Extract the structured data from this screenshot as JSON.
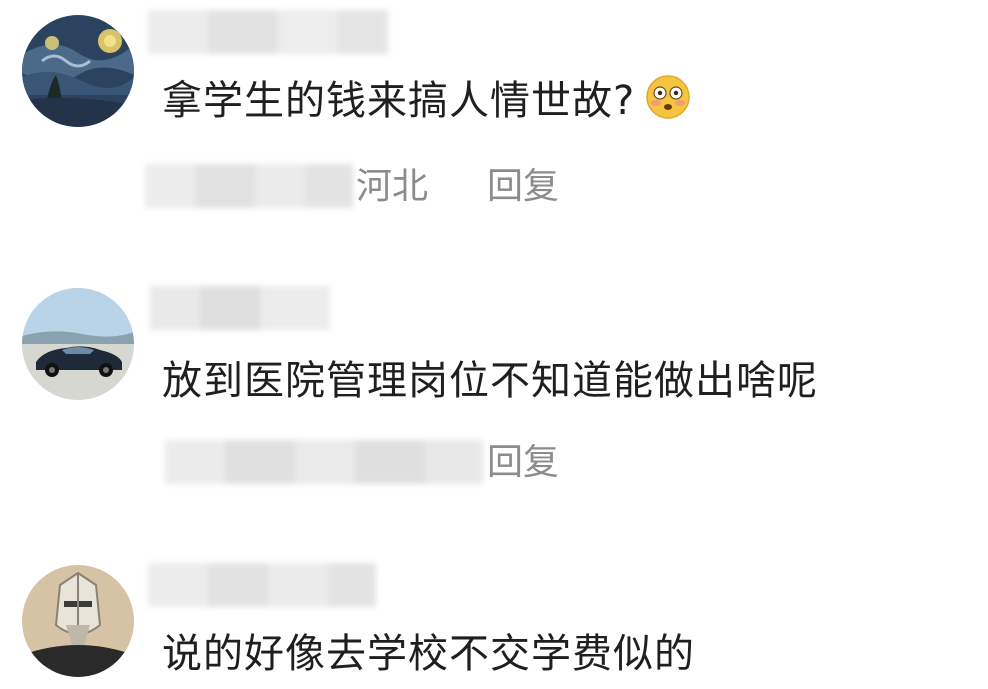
{
  "comments": [
    {
      "text": "拿学生的钱来搞人情世故?",
      "emoji": "flushed-face-emoji",
      "location": "河北",
      "reply_label": "回复"
    },
    {
      "text": "放到医院管理岗位不知道能做出啥呢",
      "reply_label": "回复"
    },
    {
      "text": "说的好像去学校不交学费似的"
    }
  ],
  "colors": {
    "text": "#1f1f1f",
    "meta": "#8c8c8c",
    "blur": "#e6e6e6"
  }
}
